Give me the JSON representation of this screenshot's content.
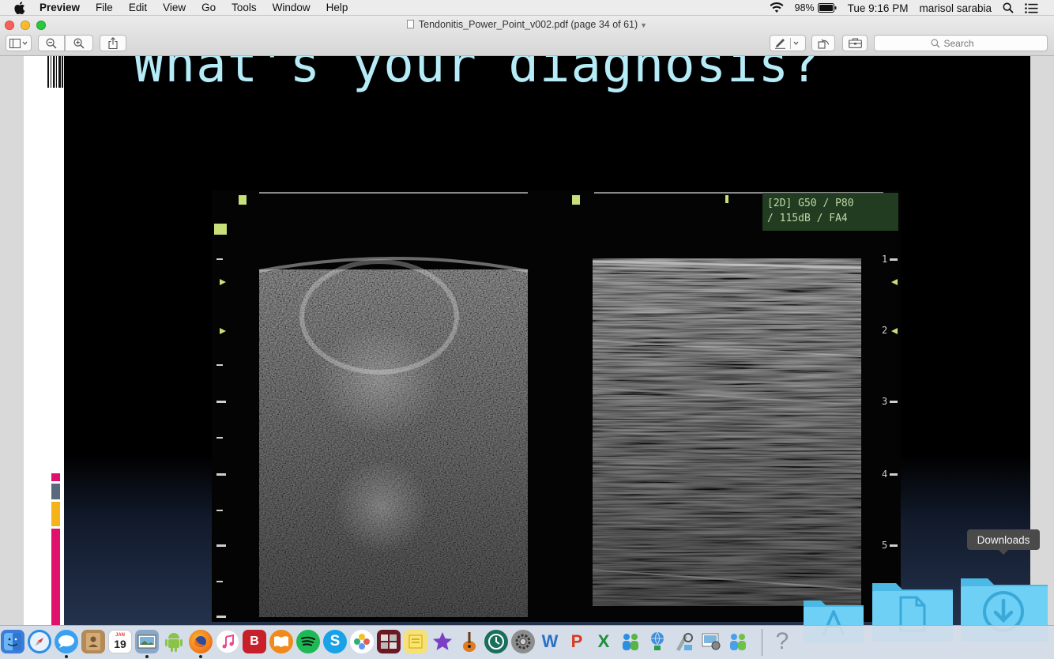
{
  "menubar": {
    "app_name": "Preview",
    "items": [
      "File",
      "Edit",
      "View",
      "Go",
      "Tools",
      "Window",
      "Help"
    ],
    "battery": "98%",
    "clock": "Tue 9:16 PM",
    "user": "marisol sarabia"
  },
  "window": {
    "title": "Tendonitis_Power_Point_v002.pdf (page 34 of 61)",
    "search_placeholder": "Search"
  },
  "slide": {
    "title": "What’s your diagnosis?",
    "image_overlay_line1": "[2D] G50 / P80",
    "image_overlay_line2": "/ 115dB / FA4",
    "depth_marks": [
      "1",
      "2",
      "3",
      "4",
      "5"
    ]
  },
  "tooltip": "Downloads",
  "dock": {
    "calendar_month": "JAN",
    "calendar_day": "19",
    "apps": [
      "finder-icon",
      "safari-icon",
      "messages-icon",
      "contacts-icon",
      "calendar-icon",
      "preview-icon",
      "android-icon",
      "firefox-icon",
      "itunes-icon",
      "bitdefender-icon",
      "ibooks-icon",
      "spotify-icon",
      "skype-icon",
      "photos-icon",
      "photo-booth-icon",
      "stickies-icon",
      "imovie-icon",
      "garageband-icon",
      "time-machine-icon",
      "system-preferences-icon",
      "word-icon",
      "powerpoint-icon",
      "excel-icon",
      "lync-icon",
      "network-icon",
      "directory-utility-icon",
      "image-capture-icon",
      "communicator-icon",
      "help-icon",
      "applications-folder-icon",
      "documents-folder-icon",
      "downloads-folder-icon"
    ]
  },
  "colors": {
    "slide_title": "#b5ecf7",
    "accent_magenta": "#e0106d",
    "accent_gray": "#5a6a7e",
    "accent_yellow": "#f5b31a",
    "folder_blue": "#5ac8f0"
  }
}
